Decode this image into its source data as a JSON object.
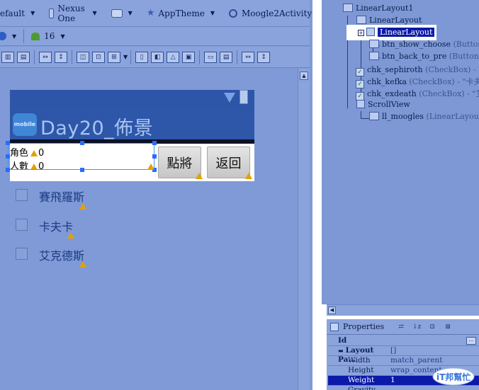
{
  "toolbar_row1": {
    "config": "efault",
    "device": "Nexus One",
    "theme": "AppTheme",
    "activity": "Moogle2Activity"
  },
  "toolbar_row2": {
    "api_level": "16"
  },
  "device": {
    "app_title": "Day20_佈景",
    "app_icon_text": "mobile",
    "info_role_label": "角色",
    "info_role_value": "0",
    "info_people_label": "人數",
    "info_people_value": "0",
    "btn_show_choose": "點將",
    "btn_back": "返回",
    "checkboxes": [
      {
        "label": "賽飛羅斯"
      },
      {
        "label": "卡夫卡"
      },
      {
        "label": "艾克德斯"
      }
    ]
  },
  "outline": {
    "items": [
      {
        "name": "LinearLayout1",
        "type": ""
      },
      {
        "name": "LinearLayout",
        "type": ""
      },
      {
        "name": "LinearLayout",
        "type": ""
      },
      {
        "name": "btn_show_choose",
        "type": "(Button) -"
      },
      {
        "name": "btn_back_to_pre",
        "type": "(Button) -"
      },
      {
        "name": "chk_sephiroth",
        "type": "(CheckBox) - \"賽"
      },
      {
        "name": "chk_kefka",
        "type": "(CheckBox) - \"卡夫卡"
      },
      {
        "name": "chk_exdeath",
        "type": "(CheckBox) - \"艾克"
      },
      {
        "name": "ScrollView",
        "type": ""
      },
      {
        "name": "ll_moogles",
        "type": "(LinearLayout)"
      }
    ]
  },
  "properties": {
    "title": "Properties",
    "rows": [
      {
        "key": "Id",
        "value": "..."
      },
      {
        "key": "Layout Pa...",
        "value": "[]"
      },
      {
        "key": "Width",
        "value": "match_parent"
      },
      {
        "key": "Height",
        "value": "wrap_content"
      },
      {
        "key": "Weight",
        "value": "1"
      },
      {
        "key": "Gravity",
        "value": ""
      }
    ]
  },
  "watermark": "iT邦幫忙",
  "colors": {
    "selection": "#0b1aa8",
    "actionbar": "#2e57a9",
    "background": "#7f9ad6"
  }
}
